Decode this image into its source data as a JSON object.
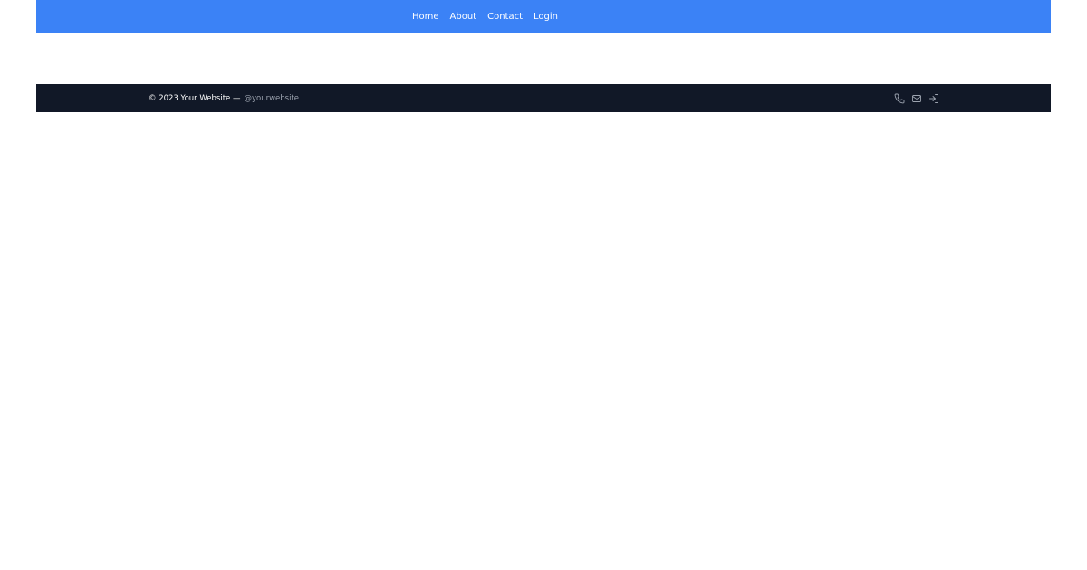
{
  "colors": {
    "header_bg": "#3b82f6",
    "footer_bg": "#111827",
    "link_text": "#ffffff",
    "handle_text": "#9ca3af",
    "icon_color": "#9ca3af"
  },
  "nav": {
    "items": [
      {
        "label": "Home"
      },
      {
        "label": "About"
      },
      {
        "label": "Contact"
      },
      {
        "label": "Login"
      }
    ]
  },
  "footer": {
    "copyright": "© 2023 Your Website —",
    "handle": "@yourwebsite",
    "icons": [
      {
        "name": "phone-icon"
      },
      {
        "name": "mail-icon"
      },
      {
        "name": "login-icon"
      }
    ]
  }
}
